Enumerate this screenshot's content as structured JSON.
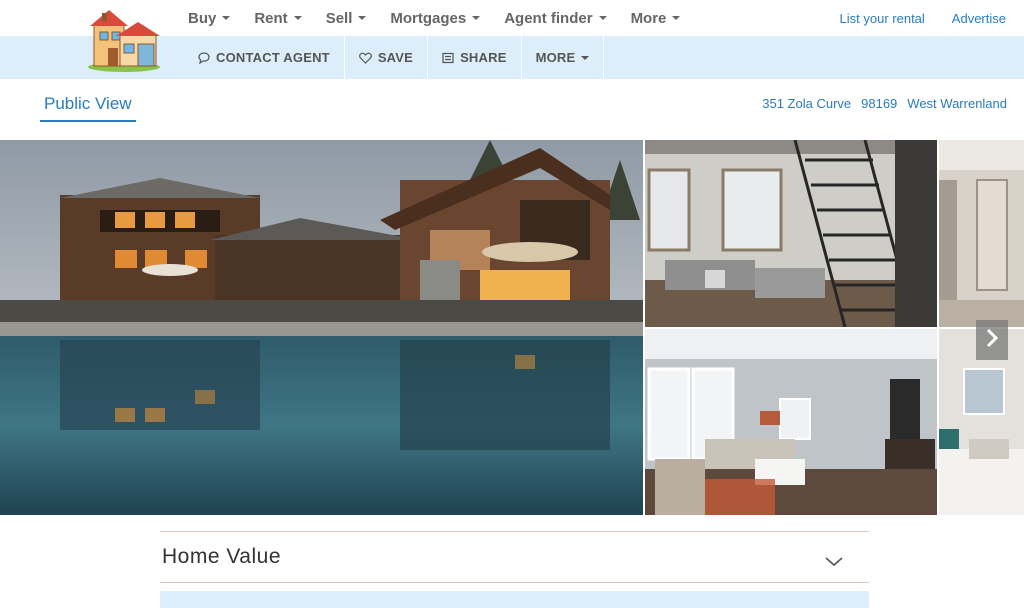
{
  "brand": {
    "logo_icon": "house-logo-icon"
  },
  "nav": {
    "items": [
      {
        "label": "Buy"
      },
      {
        "label": "Rent"
      },
      {
        "label": "Sell"
      },
      {
        "label": "Mortgages"
      },
      {
        "label": "Agent finder"
      },
      {
        "label": "More"
      }
    ],
    "right_links": [
      {
        "label": "List your rental"
      },
      {
        "label": "Advertise"
      }
    ]
  },
  "actions": [
    {
      "label": "CONTACT AGENT",
      "icon": "chat-bubble-icon"
    },
    {
      "label": "SAVE",
      "icon": "heart-icon"
    },
    {
      "label": "SHARE",
      "icon": "share-box-icon"
    },
    {
      "label": "MORE",
      "icon": "chevron-down-icon"
    }
  ],
  "view_tab": "Public View",
  "address": {
    "street": "351 Zola Curve",
    "zip": "98169",
    "city": "West Warrenland"
  },
  "gallery": {
    "photos": [
      "house-exterior-pool",
      "loft-living-room-staircase",
      "hallway-interior",
      "living-room-grey",
      "living-room-white"
    ],
    "next_icon": "chevron-right-icon"
  },
  "home_value": {
    "title": "Home Value",
    "icon": "chevron-down-icon"
  },
  "colors": {
    "accent": "#2a7bc0",
    "action_bar": "#dbeef9",
    "nav_text": "#666666"
  }
}
